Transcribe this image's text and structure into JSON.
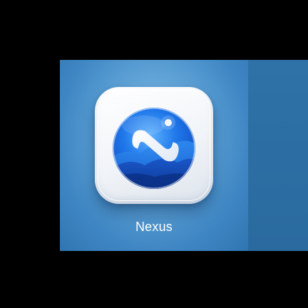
{
  "app": {
    "name": "Nexus",
    "icon": "nexus-app-icon"
  },
  "colors": {
    "background": "#000000",
    "tile": "#4a8fcb",
    "card": "#f3f5f8",
    "orb_primary": "#1f6fe0",
    "orb_dark": "#0b3fa8",
    "label": "#ffffff"
  }
}
